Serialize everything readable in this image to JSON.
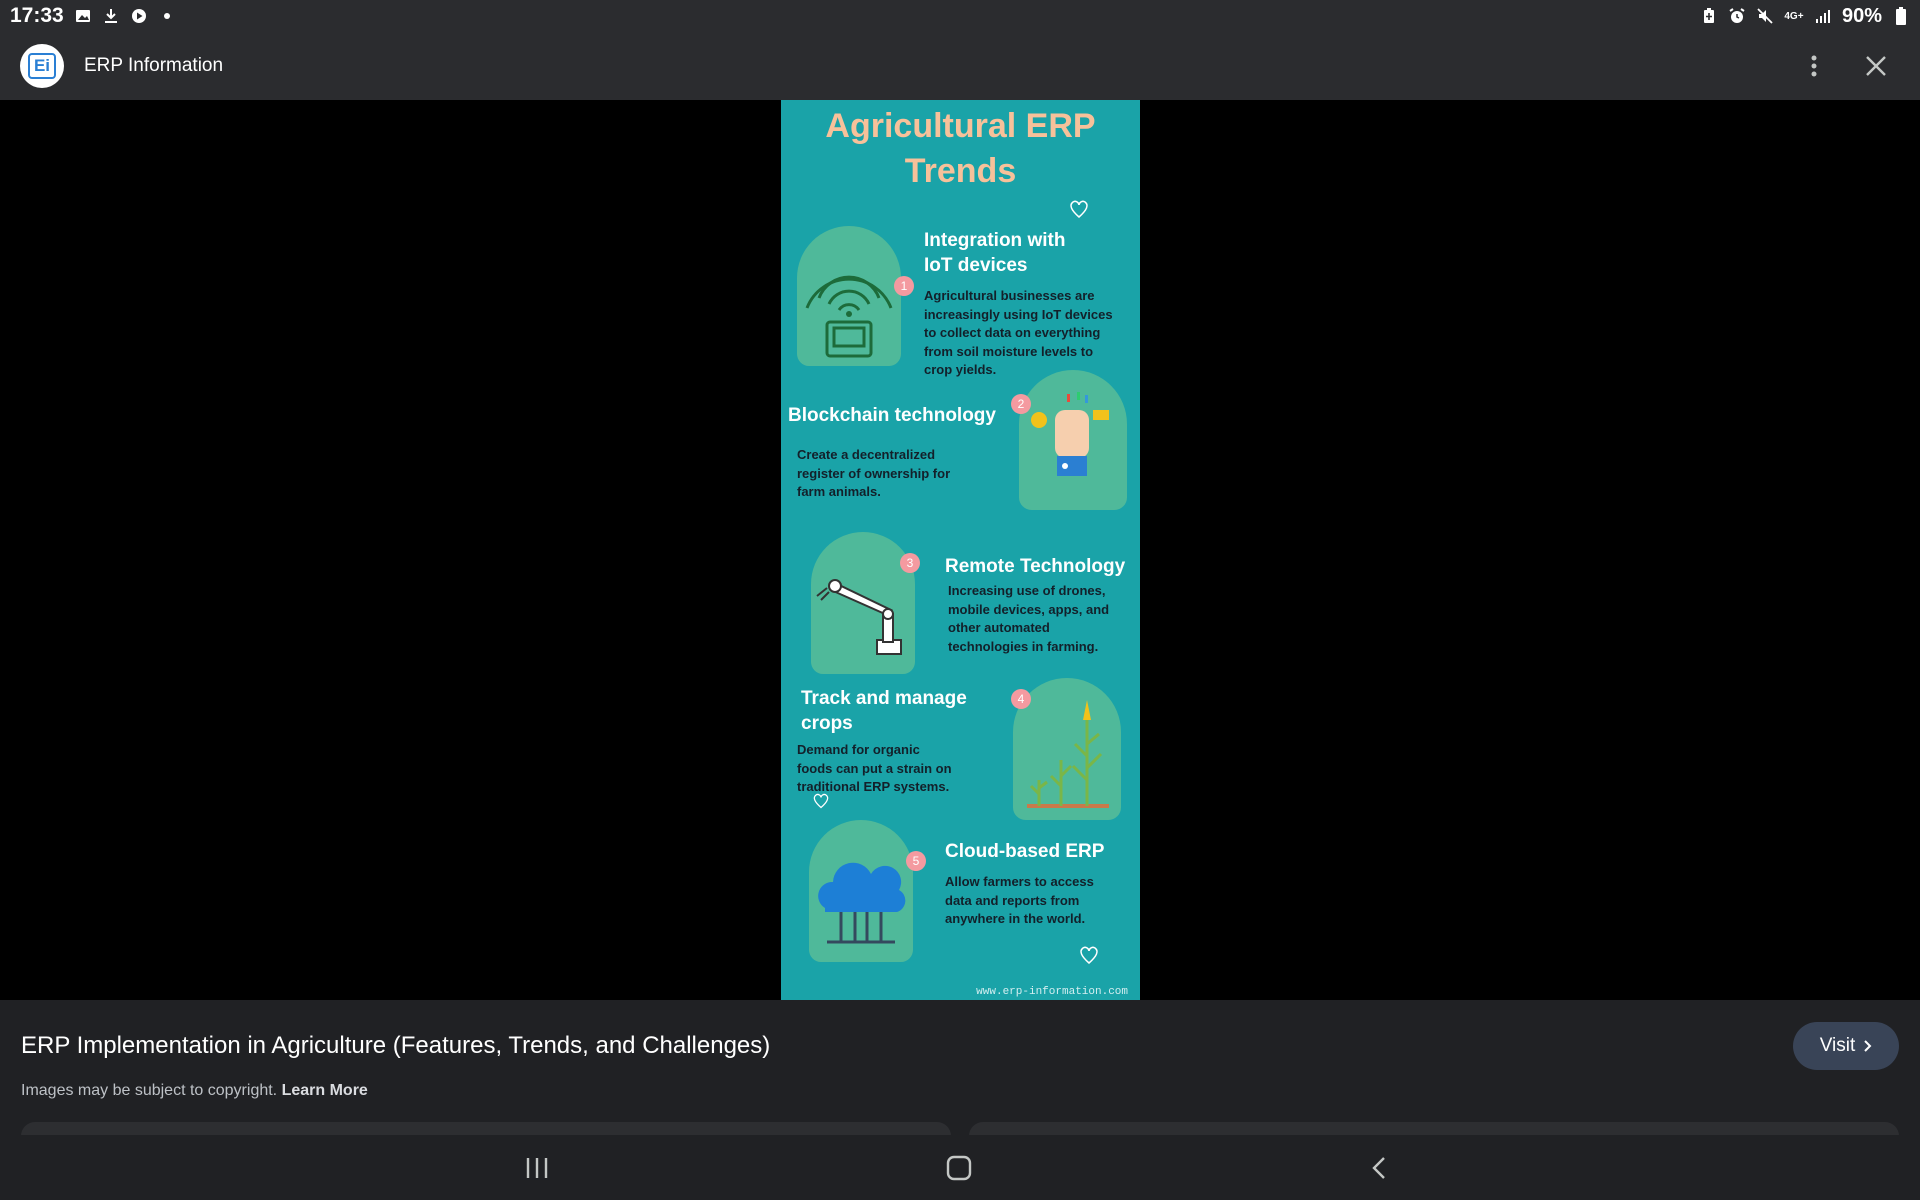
{
  "status_bar": {
    "time": "17:33",
    "battery": "90%",
    "left_icons": [
      "gallery-icon",
      "download-icon",
      "play-store-icon",
      "dot-icon"
    ],
    "right_icons": [
      "battery-saver-icon",
      "alarm-icon",
      "mute-icon",
      "network-4g-icon",
      "signal-icon",
      "battery-icon"
    ]
  },
  "header": {
    "logo_text": "Ei",
    "site_name": "ERP Information"
  },
  "infographic": {
    "title_line1": "Agricultural ERP",
    "title_line2": "Trends",
    "items": [
      {
        "number": "1",
        "heading_line1": "Integration with",
        "heading_line2": "IoT devices",
        "body": [
          "Agricultural businesses are",
          "increasingly using IoT devices",
          "to collect data on everything",
          "from soil moisture levels to",
          "crop yields."
        ]
      },
      {
        "number": "2",
        "heading_line1": "Blockchain technology",
        "heading_line2": "",
        "body": [
          "Create a decentralized",
          "register of ownership for",
          "farm animals."
        ]
      },
      {
        "number": "3",
        "heading_line1": "Remote Technology",
        "heading_line2": "",
        "body": [
          "Increasing use of drones,",
          "mobile devices, apps, and",
          "other automated",
          "technologies in farming."
        ]
      },
      {
        "number": "4",
        "heading_line1": "Track and manage",
        "heading_line2": "crops",
        "body": [
          "Demand for organic",
          "foods can put a strain on",
          "traditional ERP systems."
        ]
      },
      {
        "number": "5",
        "heading_line1": "Cloud-based ERP",
        "heading_line2": "",
        "body": [
          "Allow farmers to access",
          "data and reports from",
          "anywhere in the world."
        ]
      }
    ],
    "footer_url": "www.erp-information.com"
  },
  "info_panel": {
    "title": "ERP Implementation in Agriculture (Features, Trends, and Challenges)",
    "copyright": "Images may be subject to copyright.",
    "learn_more": "Learn More",
    "visit_label": "Visit"
  },
  "colors": {
    "infographic_bg": "#1aa3a8",
    "title_color": "#f7c19a",
    "accent_number": "#f49aa0",
    "visit_button": "#394457"
  }
}
